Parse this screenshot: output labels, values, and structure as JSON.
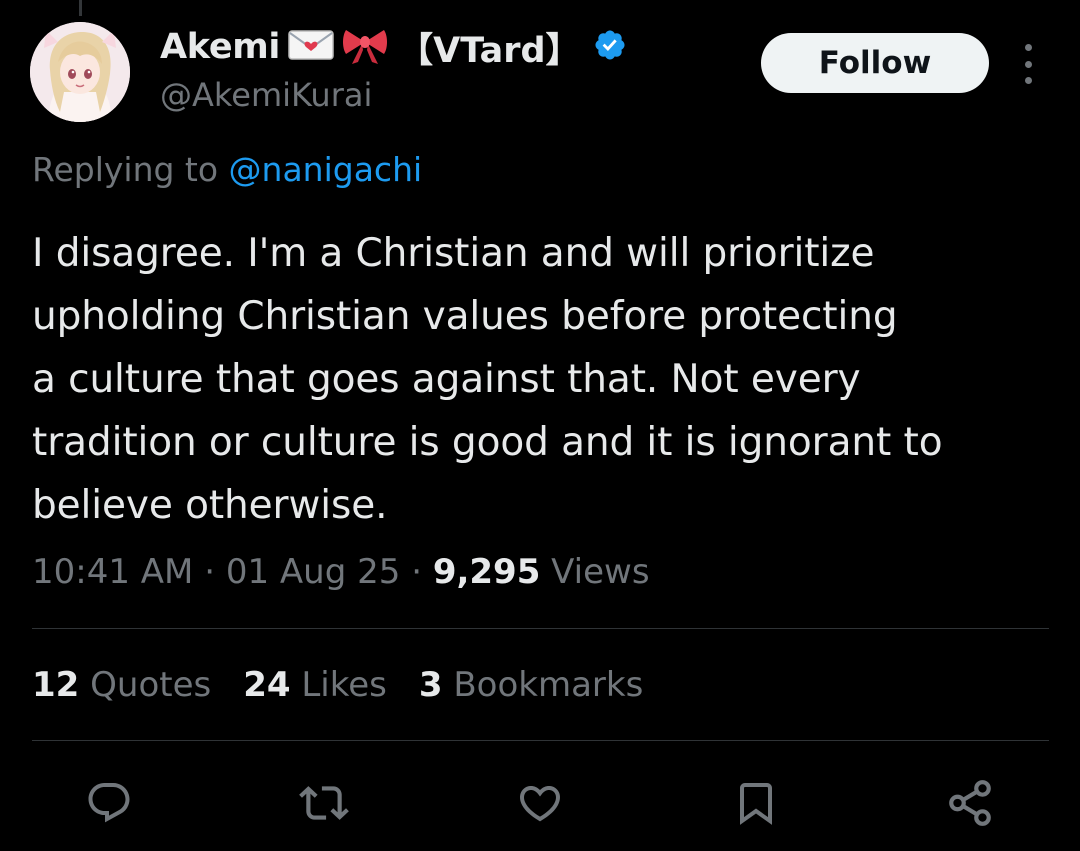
{
  "author": {
    "display_name": "Akemi",
    "name_emoji": "envelope-with-heart and ribbon",
    "name_tag": "【VTard】",
    "handle": "@AkemiKurai",
    "verified": true,
    "avatar_icon": "avatar-anime-girl"
  },
  "header": {
    "follow_label": "Follow",
    "more_icon": "more-vertical-icon"
  },
  "reply": {
    "prefix": "Replying to",
    "mention": "@nanigachi"
  },
  "tweet": {
    "lines": [
      "I disagree. I'm a Christian and will prioritize",
      "upholding Christian values before protecting",
      "a culture that goes against that. Not every",
      "tradition or culture is good and it is ignorant to",
      "believe otherwise."
    ]
  },
  "meta": {
    "time": "10:41 AM",
    "separator": "·",
    "date": "01 Aug 25",
    "views_count": "9,295",
    "views_label": "Views"
  },
  "stats": {
    "quotes_count": "12",
    "quotes_label": "Quotes",
    "likes_count": "24",
    "likes_label": "Likes",
    "bookmarks_count": "3",
    "bookmarks_label": "Bookmarks"
  },
  "actions": [
    "reply-icon",
    "retweet-icon",
    "like-icon",
    "bookmark-icon",
    "share-icon"
  ],
  "colors": {
    "background": "#000000",
    "text_primary": "#e7e9ea",
    "text_secondary": "#71767b",
    "accent": "#1d9bf0",
    "follow_bg": "#eff3f4",
    "divider": "#2f3336"
  }
}
